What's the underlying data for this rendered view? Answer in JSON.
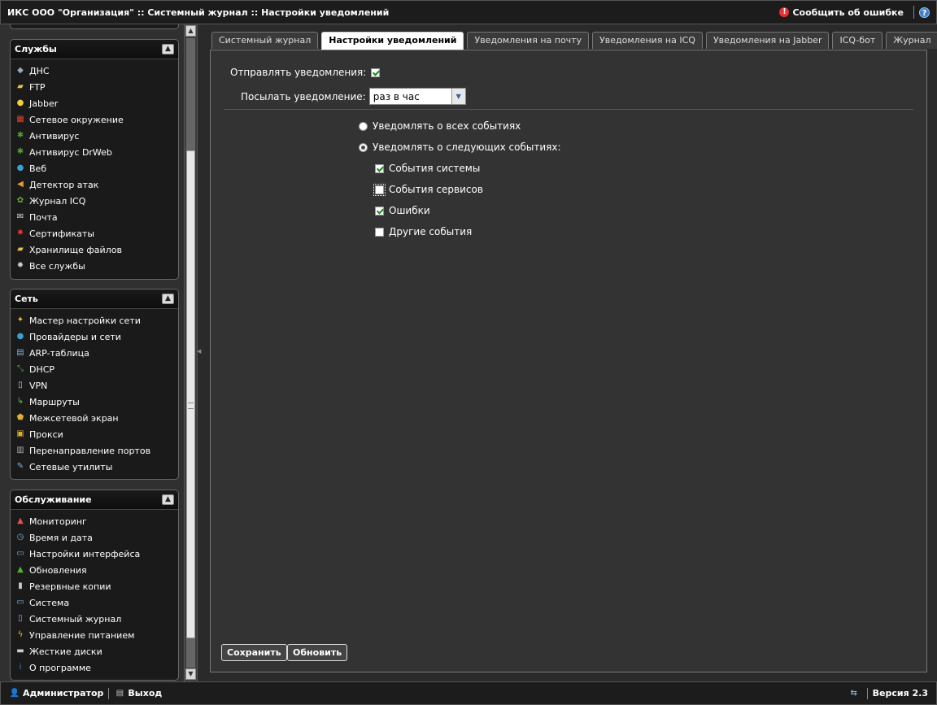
{
  "header": {
    "title": "ИКС ООО \"Организация\" :: Системный журнал :: Настройки уведомлений",
    "report_label": "Сообщить об ошибке",
    "help_icon": "help-icon"
  },
  "sidebar": {
    "services": {
      "title": "Службы",
      "items": [
        {
          "label": "ДНС",
          "icon": "tag-icon",
          "color": "#9ab"
        },
        {
          "label": "FTP",
          "icon": "folder-icon",
          "color": "#e8c04a"
        },
        {
          "label": "Jabber",
          "icon": "bulb-icon",
          "color": "#f0d040"
        },
        {
          "label": "Сетевое окружение",
          "icon": "network-icon",
          "color": "#e04030"
        },
        {
          "label": "Антивирус",
          "icon": "bug-icon",
          "color": "#50a030"
        },
        {
          "label": "Антивирус DrWeb",
          "icon": "bug-icon",
          "color": "#50a030"
        },
        {
          "label": "Веб",
          "icon": "globe-icon",
          "color": "#3aa0d0"
        },
        {
          "label": "Детектор атак",
          "icon": "horn-icon",
          "color": "#e0a030"
        },
        {
          "label": "Журнал ICQ",
          "icon": "flower-icon",
          "color": "#60b030"
        },
        {
          "label": "Почта",
          "icon": "mail-icon",
          "color": "#dde"
        },
        {
          "label": "Сертификаты",
          "icon": "ribbon-icon",
          "color": "#e03030"
        },
        {
          "label": "Хранилище файлов",
          "icon": "folder-icon",
          "color": "#e8c04a"
        },
        {
          "label": "Все службы",
          "icon": "gear-icon",
          "color": "#ccc"
        }
      ]
    },
    "network": {
      "title": "Сеть",
      "items": [
        {
          "label": "Мастер настройки сети",
          "icon": "wand-icon",
          "color": "#e0c040"
        },
        {
          "label": "Провайдеры и сети",
          "icon": "globe-icon",
          "color": "#3aa0d0"
        },
        {
          "label": "ARP-таблица",
          "icon": "table-icon",
          "color": "#7ab0e0"
        },
        {
          "label": "DHCP",
          "icon": "arrows-icon",
          "color": "#50b050"
        },
        {
          "label": "VPN",
          "icon": "doc-icon",
          "color": "#ccc"
        },
        {
          "label": "Маршруты",
          "icon": "route-icon",
          "color": "#60c040"
        },
        {
          "label": "Межсетевой экран",
          "icon": "shield-icon",
          "color": "#e0b030"
        },
        {
          "label": "Прокси",
          "icon": "lock-icon",
          "color": "#e0b030"
        },
        {
          "label": "Перенаправление портов",
          "icon": "port-icon",
          "color": "#aaa"
        },
        {
          "label": "Сетевые утилиты",
          "icon": "wrench-icon",
          "color": "#7ab0e0"
        }
      ]
    },
    "maintenance": {
      "title": "Обслуживание",
      "items": [
        {
          "label": "Мониторинг",
          "icon": "chart-icon",
          "color": "#e05050"
        },
        {
          "label": "Время и дата",
          "icon": "clock-icon",
          "color": "#7ab0e0"
        },
        {
          "label": "Настройки интерфейса",
          "icon": "window-icon",
          "color": "#7ab0e0"
        },
        {
          "label": "Обновления",
          "icon": "arrow-up-icon",
          "color": "#50b030"
        },
        {
          "label": "Резервные копии",
          "icon": "database-icon",
          "color": "#ccc"
        },
        {
          "label": "Система",
          "icon": "monitor-icon",
          "color": "#7ab0e0"
        },
        {
          "label": "Системный журнал",
          "icon": "book-icon",
          "color": "#7ab0e0"
        },
        {
          "label": "Управление питанием",
          "icon": "lightning-icon",
          "color": "#f0c020"
        },
        {
          "label": "Жесткие диски",
          "icon": "disk-icon",
          "color": "#ccc"
        },
        {
          "label": "О программе",
          "icon": "info-icon",
          "color": "#3a80d0"
        }
      ]
    }
  },
  "tabs": [
    {
      "label": "Системный журнал",
      "active": false
    },
    {
      "label": "Настройки уведомлений",
      "active": true
    },
    {
      "label": "Уведомления на почту",
      "active": false
    },
    {
      "label": "Уведомления на ICQ",
      "active": false
    },
    {
      "label": "Уведомления на Jabber",
      "active": false
    },
    {
      "label": "ICQ-бот",
      "active": false
    },
    {
      "label": "Журнал",
      "active": false
    }
  ],
  "form": {
    "send_label": "Отправлять уведомления:",
    "send_checked": true,
    "frequency_label": "Посылать уведомление:",
    "frequency_value": "раз в час",
    "radio_all": "Уведомлять о всех событиях",
    "radio_selected": "Уведомлять о следующих событиях:",
    "radio_choice": "selected",
    "events": [
      {
        "label": "События системы",
        "checked": true
      },
      {
        "label": "События сервисов",
        "checked": false
      },
      {
        "label": "Ошибки",
        "checked": true
      },
      {
        "label": "Другие события",
        "checked": false
      }
    ],
    "save_label": "Сохранить",
    "refresh_label": "Обновить"
  },
  "footer": {
    "user_label": "Администратор",
    "logout_label": "Выход",
    "version_label": "Версия 2.3"
  }
}
